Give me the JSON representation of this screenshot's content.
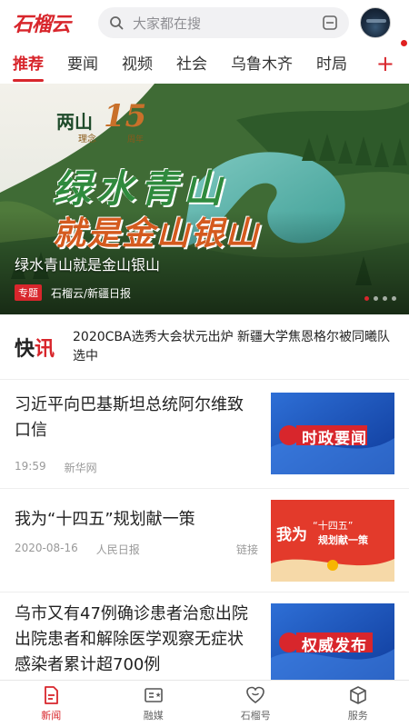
{
  "header": {
    "logo_text": "石榴云",
    "search_placeholder": "大家都在搜"
  },
  "tabs": [
    "推荐",
    "要闻",
    "视频",
    "社会",
    "乌鲁木齐",
    "时局"
  ],
  "tabs_add": "+",
  "banner": {
    "series_label_top": "两山",
    "series_label_sub": "理念",
    "series_number": "15",
    "series_suffix": "周年",
    "slogan_line1": "绿水青山",
    "slogan_line2": "就是金山银山",
    "caption": "绿水青山就是金山银山",
    "tag": "专题",
    "source": "石榴云/新疆日报"
  },
  "flash": {
    "title_a": "快",
    "title_b": "讯",
    "text": "2020CBA选秀大会状元出炉 新疆大学焦恩格尔被同曦队选中"
  },
  "news": [
    {
      "title": "习近平向巴基斯坦总统阿尔维致口信",
      "time": "19:59",
      "source": "新华网",
      "extra": "",
      "thumb_text": "时政要闻"
    },
    {
      "title": "我为“十四五”规划献一策",
      "time": "2020-08-16",
      "source": "人民日报",
      "extra": "链接",
      "thumb_text_a": "我为",
      "thumb_text_b": "“十四五”",
      "thumb_text_c": "规划献一策"
    },
    {
      "title": "乌市又有47例确诊患者治愈出院 出院患者和解除医学观察无症状感染者累计超700例",
      "thumb_text": "权威发布"
    }
  ],
  "bottom_nav": [
    "新闻",
    "融媒",
    "石榴号",
    "服务"
  ],
  "colors": {
    "accent": "#d8262c"
  }
}
